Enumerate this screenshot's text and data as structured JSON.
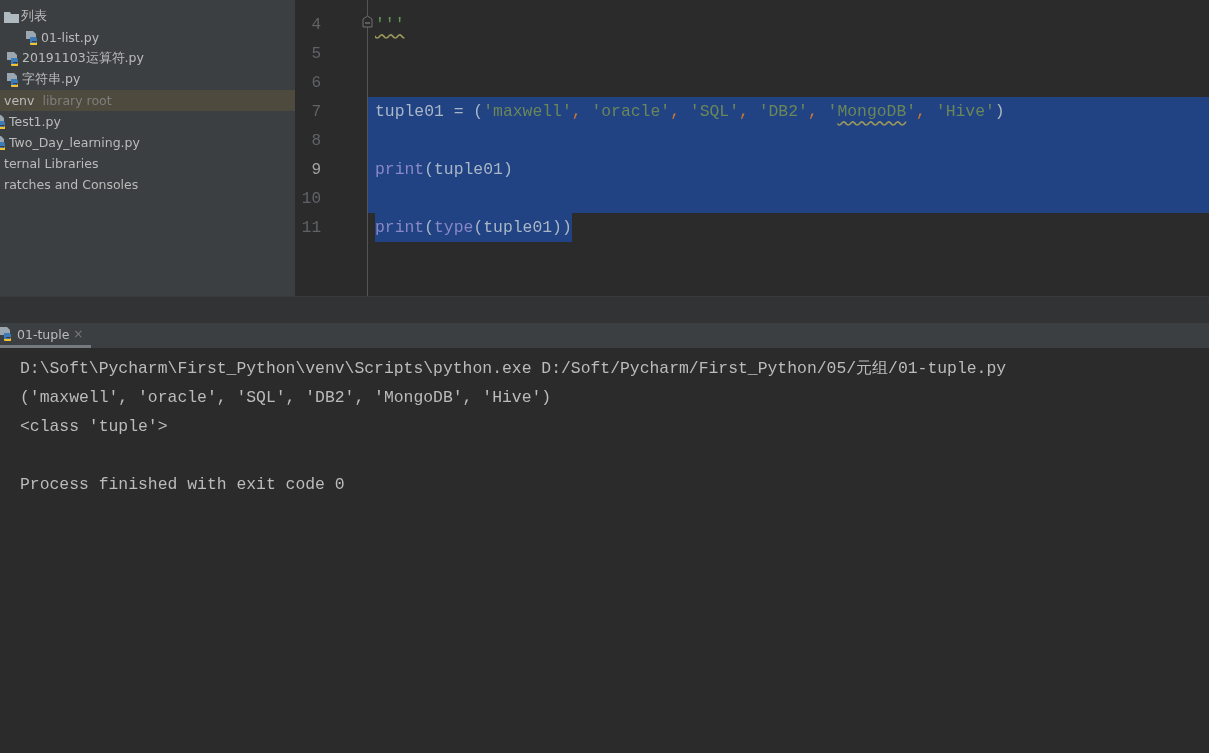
{
  "sidebar": {
    "nested_items": [
      {
        "kind": "folder",
        "label": "列表",
        "selected": false,
        "children": [
          {
            "kind": "python",
            "label": "01-list.py",
            "selected": false
          }
        ]
      },
      {
        "kind": "python",
        "label": "20191103运算符.py",
        "selected": false
      },
      {
        "kind": "python",
        "label": "字符串.py",
        "selected": false
      }
    ],
    "items": [
      {
        "kind": "root",
        "label": "venv",
        "hint": "library root",
        "selected": true
      },
      {
        "kind": "python",
        "label": "Test1.py",
        "selected": false
      },
      {
        "kind": "python",
        "label": "Two_Day_learning.py",
        "selected": false
      },
      {
        "kind": "plain",
        "label": "ternal Libraries",
        "selected": false
      },
      {
        "kind": "plain",
        "label": "ratches and Consoles",
        "selected": false
      }
    ]
  },
  "editor": {
    "lines": [
      {
        "number": "4",
        "current": false,
        "selected": false,
        "fold": true,
        "tokens": [
          {
            "kind": "docstring",
            "text": "'''",
            "typo": true
          }
        ]
      },
      {
        "number": "5",
        "current": false,
        "selected": false
      },
      {
        "number": "6",
        "current": false,
        "selected": false
      },
      {
        "number": "7",
        "current": false,
        "selected": true,
        "tokens": [
          {
            "kind": "plain",
            "text": "tuple01 = ("
          },
          {
            "kind": "string",
            "text": "'maxwell'"
          },
          {
            "kind": "comma",
            "text": ", "
          },
          {
            "kind": "string",
            "text": "'oracle'"
          },
          {
            "kind": "comma",
            "text": ", "
          },
          {
            "kind": "string",
            "text": "'SQL'"
          },
          {
            "kind": "comma",
            "text": ", "
          },
          {
            "kind": "string",
            "text": "'DB2'"
          },
          {
            "kind": "comma",
            "text": ", "
          },
          {
            "kind": "string",
            "text": "'"
          },
          {
            "kind": "string",
            "text": "MongoDB",
            "typo": true
          },
          {
            "kind": "string",
            "text": "'"
          },
          {
            "kind": "comma",
            "text": ", "
          },
          {
            "kind": "string",
            "text": "'Hive'"
          },
          {
            "kind": "plain",
            "text": ")"
          }
        ]
      },
      {
        "number": "8",
        "current": false,
        "selected": true
      },
      {
        "number": "9",
        "current": true,
        "selected": true,
        "tokens": [
          {
            "kind": "builtin",
            "text": "print"
          },
          {
            "kind": "plain",
            "text": "(tuple01)"
          }
        ]
      },
      {
        "number": "10",
        "current": false,
        "selected": true
      },
      {
        "number": "11",
        "current": false,
        "selected": true,
        "tokens": [
          {
            "kind": "builtin",
            "text": "print"
          },
          {
            "kind": "plain",
            "text": "("
          },
          {
            "kind": "builtin",
            "text": "type"
          },
          {
            "kind": "plain",
            "text": "(tuple01))"
          }
        ]
      }
    ]
  },
  "run_panel": {
    "tabs": [
      {
        "label": "01-tuple",
        "close": "×",
        "selected": true
      }
    ],
    "console": [
      {
        "kind": "command",
        "text": "D:\\Soft\\Pycharm\\First_Python\\venv\\Scripts\\python.exe D:/Soft/Pycharm/First_Python/05/元组/01-tuple.py"
      },
      {
        "kind": "output",
        "text": "('maxwell', 'oracle', 'SQL', 'DB2', 'MongoDB', 'Hive')"
      },
      {
        "kind": "output",
        "text": "<class 'tuple'>"
      },
      {
        "kind": "exit",
        "text": "Process finished with exit code 0"
      }
    ]
  }
}
